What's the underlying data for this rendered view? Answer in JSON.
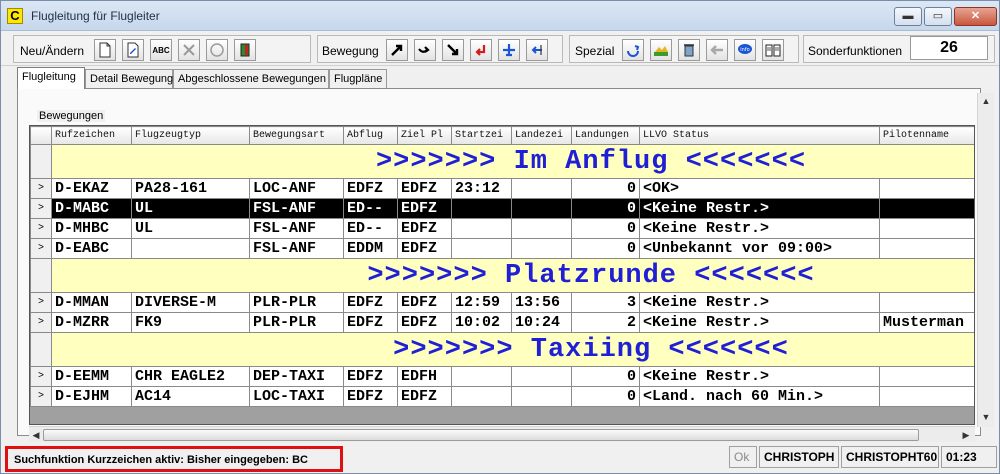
{
  "window": {
    "app_icon_letter": "C",
    "title": "Flugleitung für Flugleiter",
    "btn_min": "▬",
    "btn_max": "▭",
    "btn_close": "✕"
  },
  "toolbar": {
    "new_change_label": "Neu/Ändern",
    "movement_label": "Bewegung",
    "special_label": "Spezial",
    "sonder_label": "Sonderfunktionen",
    "counter_value": "26",
    "abc_label": "ABC"
  },
  "tabs": [
    "Flugleitung",
    "Detail Bewegung",
    "Abgeschlossene Bewegungen",
    "Flugpläne"
  ],
  "groupbox_label": "Bewegungen",
  "table": {
    "columns": [
      "Rufzeichen",
      "Flugzeugtyp",
      "Bewegungsart",
      "Abflug",
      "Ziel Pl",
      "Startzei",
      "Landezei",
      "Landungen",
      "LLVO Status",
      "Pilotenname"
    ],
    "sections": [
      {
        "title": ">>>>>>> Im Anflug <<<<<<<",
        "rows": [
          {
            "ind": ">",
            "call": "D-EKAZ",
            "type": "PA28-161",
            "move": "LOC-ANF",
            "dep": "EDFZ",
            "dest": "EDFZ",
            "start": "23:12",
            "land": "",
            "landings": "0",
            "llvo": "<OK>",
            "pilot": ""
          },
          {
            "ind": ">",
            "call": "D-MABC",
            "type": "UL",
            "move": "FSL-ANF",
            "dep": "ED--",
            "dest": "EDFZ",
            "start": "",
            "land": "",
            "landings": "0",
            "llvo": "<Keine Restr.>",
            "pilot": "",
            "selected": true
          },
          {
            "ind": ">",
            "call": "D-MHBC",
            "type": "UL",
            "move": "FSL-ANF",
            "dep": "ED--",
            "dest": "EDFZ",
            "start": "",
            "land": "",
            "landings": "0",
            "llvo": "<Keine Restr.>",
            "pilot": ""
          },
          {
            "ind": ">",
            "call": "D-EABC",
            "type": "",
            "move": "FSL-ANF",
            "dep": "EDDM",
            "dest": "EDFZ",
            "start": "",
            "land": "",
            "landings": "0",
            "llvo": "<Unbekannt vor 09:00>",
            "pilot": ""
          }
        ]
      },
      {
        "title": ">>>>>>> Platzrunde <<<<<<<",
        "rows": [
          {
            "ind": ">",
            "call": "D-MMAN",
            "type": "DIVERSE-M",
            "move": "PLR-PLR",
            "dep": "EDFZ",
            "dest": "EDFZ",
            "start": "12:59",
            "land": "13:56",
            "landings": "3",
            "llvo": "<Keine Restr.>",
            "pilot": ""
          },
          {
            "ind": ">",
            "call": "D-MZRR",
            "type": "FK9",
            "move": "PLR-PLR",
            "dep": "EDFZ",
            "dest": "EDFZ",
            "start": "10:02",
            "land": "10:24",
            "landings": "2",
            "llvo": "<Keine Restr.>",
            "pilot": "Musterman"
          }
        ]
      },
      {
        "title": ">>>>>>> Taxiing <<<<<<<",
        "rows": [
          {
            "ind": ">",
            "call": "D-EEMM",
            "type": "CHR EAGLE2",
            "move": "DEP-TAXI",
            "dep": "EDFZ",
            "dest": "EDFH",
            "start": "",
            "land": "",
            "landings": "0",
            "llvo": "<Keine Restr.>",
            "pilot": ""
          },
          {
            "ind": ">",
            "call": "D-EJHM",
            "type": "AC14",
            "move": "LOC-TAXI",
            "dep": "EDFZ",
            "dest": "EDFZ",
            "start": "",
            "land": "",
            "landings": "0",
            "llvo": "<Land. nach 60 Min.>",
            "pilot": ""
          }
        ]
      }
    ]
  },
  "status": {
    "message": "Suchfunktion Kurzzeichen aktiv: Bisher eingegeben: BC",
    "ok": "Ok",
    "user1": "CHRISTOPH",
    "user2": "CHRISTOPHT60",
    "time": "01:23"
  },
  "colors": {
    "section_text": "#1f1fd6",
    "section_bg": "#ffffc0",
    "highlight_border": "#e01010",
    "selected_row_bg": "#000000"
  }
}
